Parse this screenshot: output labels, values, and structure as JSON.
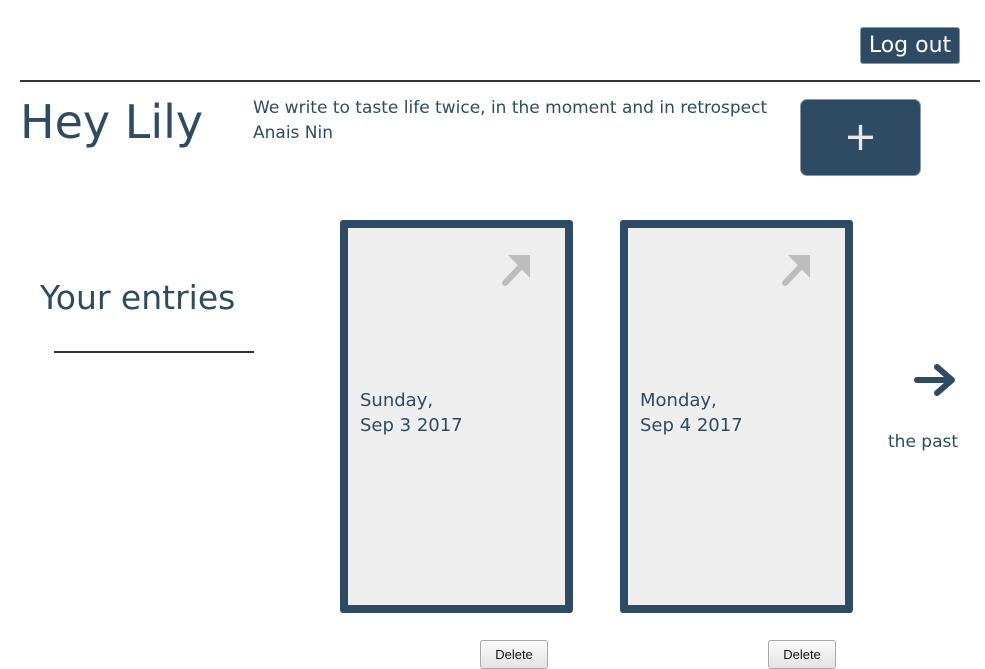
{
  "header": {
    "logout_label": "Log out"
  },
  "main": {
    "greeting": "Hey Lily",
    "quote": {
      "text": "We write to taste life twice, in the moment and in retrospect",
      "author": "Anais Nin"
    },
    "add_entry_label": "+",
    "section_title": "Your entries"
  },
  "entries": [
    {
      "day": "Sunday,",
      "date": "Sep 3 2017",
      "delete_label": "Delete",
      "open_icon": "arrow-up-right-icon"
    },
    {
      "day": "Monday,",
      "date": "Sep 4 2017",
      "delete_label": "Delete",
      "open_icon": "arrow-up-right-icon"
    }
  ],
  "navigation": {
    "next_label": "the past",
    "next_icon": "arrow-right-icon"
  },
  "colors": {
    "primary": "#2f4a63",
    "card_background": "#eeeeee",
    "card_icon": "#bdbdbd",
    "divider": "#333333"
  }
}
